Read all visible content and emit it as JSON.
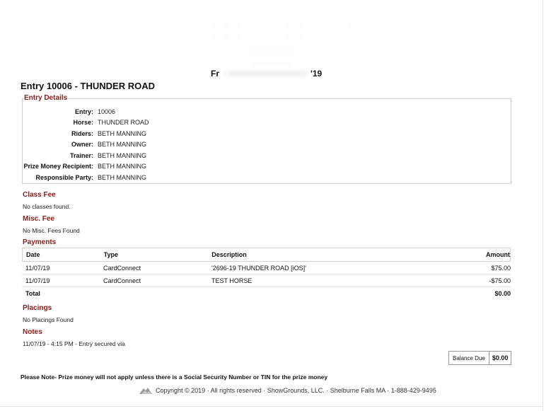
{
  "header": {
    "fr_fragment": "Fr",
    "year_fragment": "'19"
  },
  "entry_title": "Entry 10006 - THUNDER ROAD",
  "entry_details": {
    "legend": "Entry Details",
    "rows": [
      {
        "label": "Entry:",
        "value": "10006"
      },
      {
        "label": "Horse:",
        "value": "THUNDER ROAD"
      },
      {
        "label": "Riders:",
        "value": "BETH MANNING"
      },
      {
        "label": "Owner:",
        "value": "BETH MANNING"
      },
      {
        "label": "Trainer:",
        "value": "BETH MANNING"
      },
      {
        "label": "Prize Money Recipient:",
        "value": "BETH MANNING"
      },
      {
        "label": "Responsible Party:",
        "value": "BETH MANNING"
      }
    ]
  },
  "class_fee": {
    "title": "Class Fee",
    "text": "No classes found."
  },
  "misc_fee": {
    "title": "Misc. Fee",
    "text": "No Misc. Fees Found"
  },
  "payments": {
    "title": "Payments",
    "headers": {
      "date": "Date",
      "type": "Type",
      "description": "Description",
      "amount": "Amount"
    },
    "rows": [
      {
        "date": "11/07/19",
        "type": "CardConnect",
        "description": "'2696-19 THUNDER ROAD [iOS]'",
        "amount": "$75.00"
      },
      {
        "date": "11/07/19",
        "type": "CardConnect",
        "description": "TEST HORSE",
        "amount": "-$75.00"
      }
    ],
    "total_label": "Total",
    "total_amount": "$0.00"
  },
  "placings": {
    "title": "Placings",
    "text": "No Placings Found"
  },
  "notes": {
    "title": "Notes",
    "text": "11/07/19 - 4:15 PM - Entry secured via"
  },
  "balance": {
    "label": "Balance Due",
    "value": "$0.00"
  },
  "prize_note": "Please Note- Prize money will not apply unless there is a Social Security Number or TIN for the prize money",
  "footer": {
    "logo_icon": "showgrounds-logo-icon",
    "text": "Copyright © 2019 · All rights reserved · ShowGrounds, LLC. · Shelburne Falls MA · 1-888-429-9495"
  }
}
